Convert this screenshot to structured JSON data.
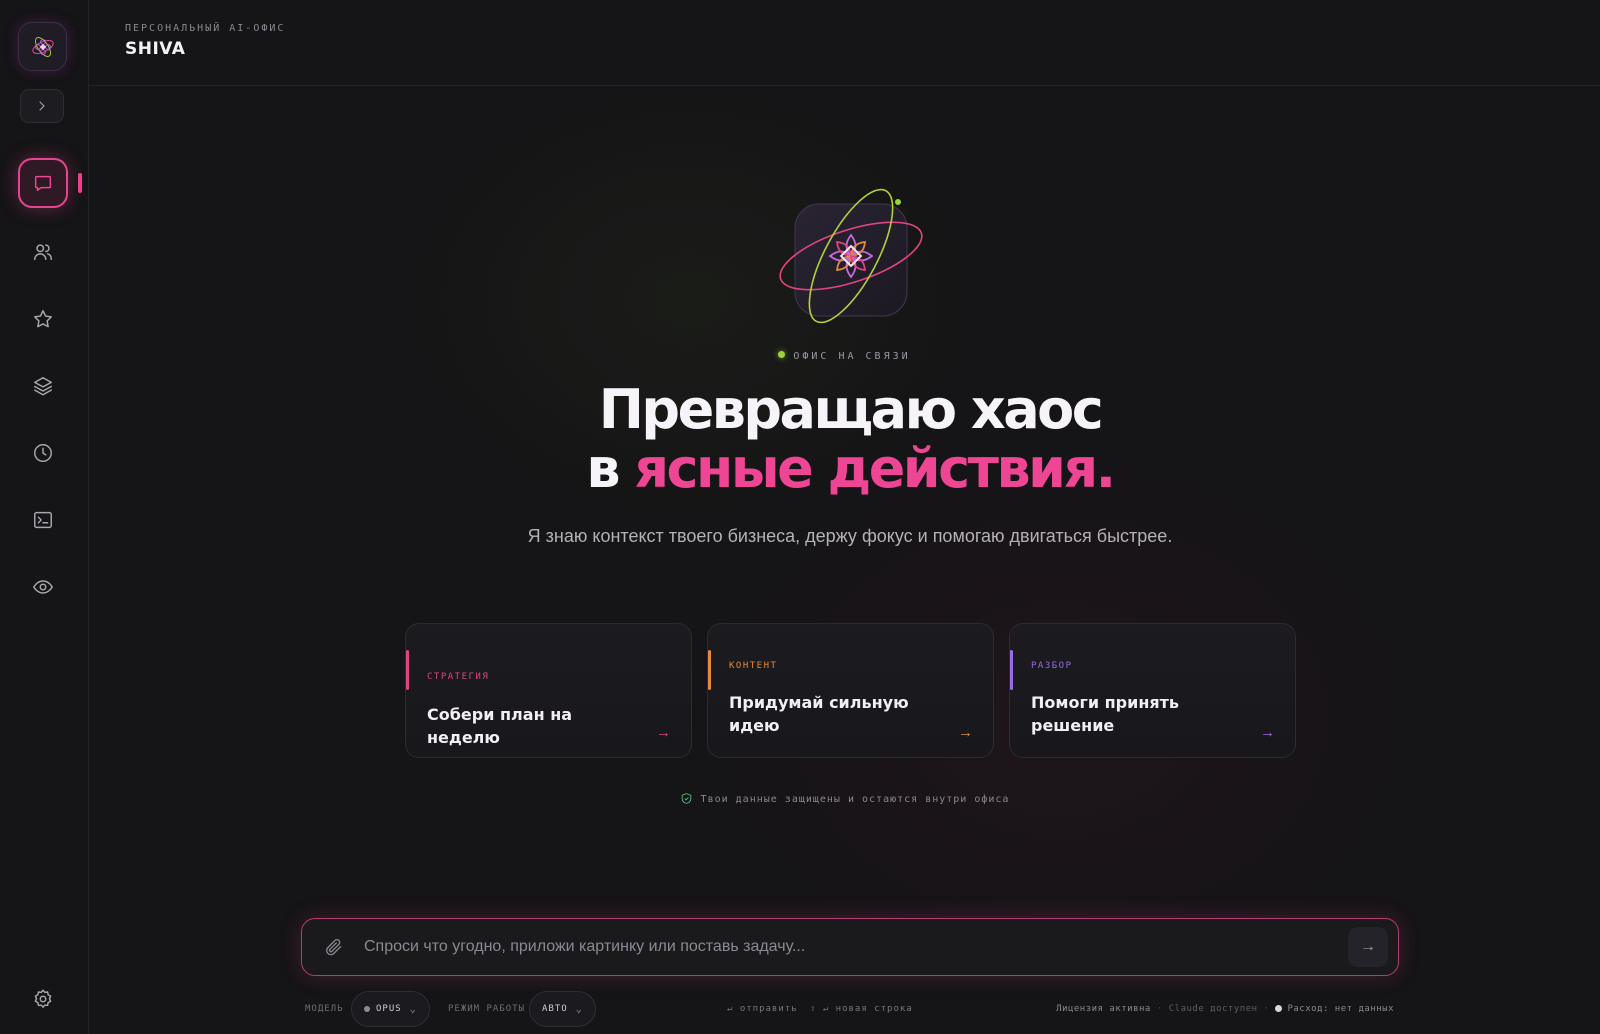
{
  "header": {
    "eyebrow": "ПЕРСОНАЛЬНЫЙ AI-ОФИС",
    "brand": "SHIVA"
  },
  "sidebar": {
    "items": [
      {
        "icon": "chat-icon",
        "active": true
      },
      {
        "icon": "users-icon",
        "active": false
      },
      {
        "icon": "star-icon",
        "active": false
      },
      {
        "icon": "layers-icon",
        "active": false
      },
      {
        "icon": "clock-icon",
        "active": false
      },
      {
        "icon": "terminal-icon",
        "active": false
      },
      {
        "icon": "eye-icon",
        "active": false
      }
    ],
    "bottom_icon": "gear-icon"
  },
  "hero": {
    "status": "ОФИС НА СВЯЗИ",
    "headline_line1": "Превращаю хаос",
    "headline_line2_prefix": "в ",
    "headline_line2_accent": "ясные действия.",
    "subline": "Я знаю контекст твоего бизнеса, держу фокус и помогаю двигаться быстрее."
  },
  "cards": [
    {
      "tag": "СТРАТЕГИЯ",
      "title": "Собери план на неделю",
      "color": "#e0447f"
    },
    {
      "tag": "КОНТЕНТ",
      "title": "Придумай сильную идею",
      "color": "#e48a3a"
    },
    {
      "tag": "РАЗБОР",
      "title": "Помоги принять решение",
      "color": "#9a6be6"
    }
  ],
  "privacy": "Твои данные защищены и остаются внутри офиса",
  "composer": {
    "placeholder": "Спроси что угодно, приложи картинку или поставь задачу..."
  },
  "footer": {
    "model_label": "МОДЕЛЬ",
    "model_value": "OPUS",
    "mode_label": "РЕЖИМ РАБОТЫ",
    "mode_value": "АВТО",
    "hint_send": "↵ отправить",
    "hint_newline": "⇧ ↵ новая строка",
    "license": "Лицензия активна",
    "claude": "Claude доступен",
    "usage": "Расход: нет данных"
  },
  "colors": {
    "accent": "#ee4694",
    "status_online": "#9ad43a",
    "privacy": "#62c28a"
  }
}
